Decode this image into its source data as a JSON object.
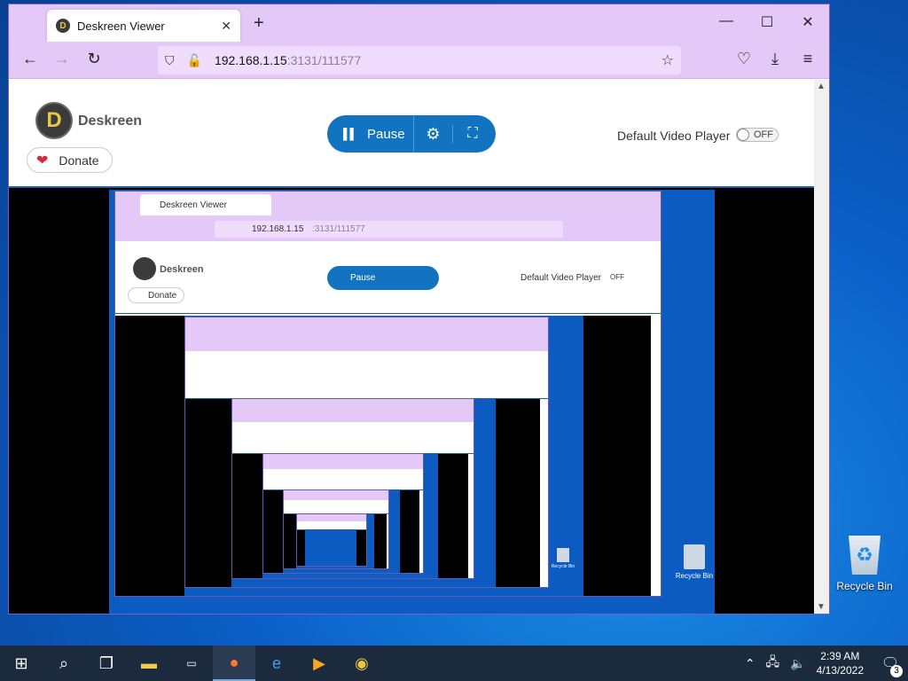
{
  "desktop": {
    "recycle_bin_label": "Recycle Bin"
  },
  "browser": {
    "tab_title": "Deskreen Viewer",
    "favicon_letter": "D",
    "url_host": "192.168.1.15",
    "url_path": ":3131/111577",
    "new_tab_icon": "plus-icon",
    "window_controls": [
      "minimize-icon",
      "maximize-icon",
      "close-icon"
    ]
  },
  "page": {
    "logo_text": "Deskreen",
    "logo_letter": "D",
    "donate_label": "Donate",
    "pause_label": "Pause",
    "default_video_player_label": "Default Video Player",
    "toggle_state": "OFF",
    "accent_color": "#1273c0"
  },
  "nested": {
    "tab_title": "Deskreen Viewer",
    "url_host": "192.168.1.15",
    "url_path": ":3131/111577",
    "logo_text": "Deskreen",
    "donate_label": "Donate",
    "pause_label": "Pause",
    "dvp_label": "Default Video Player",
    "toggle_state": "OFF",
    "recycle_bin_label": "Recycle Bin"
  },
  "taskbar": {
    "time": "2:39 AM",
    "date": "4/13/2022",
    "notification_count": "3"
  }
}
